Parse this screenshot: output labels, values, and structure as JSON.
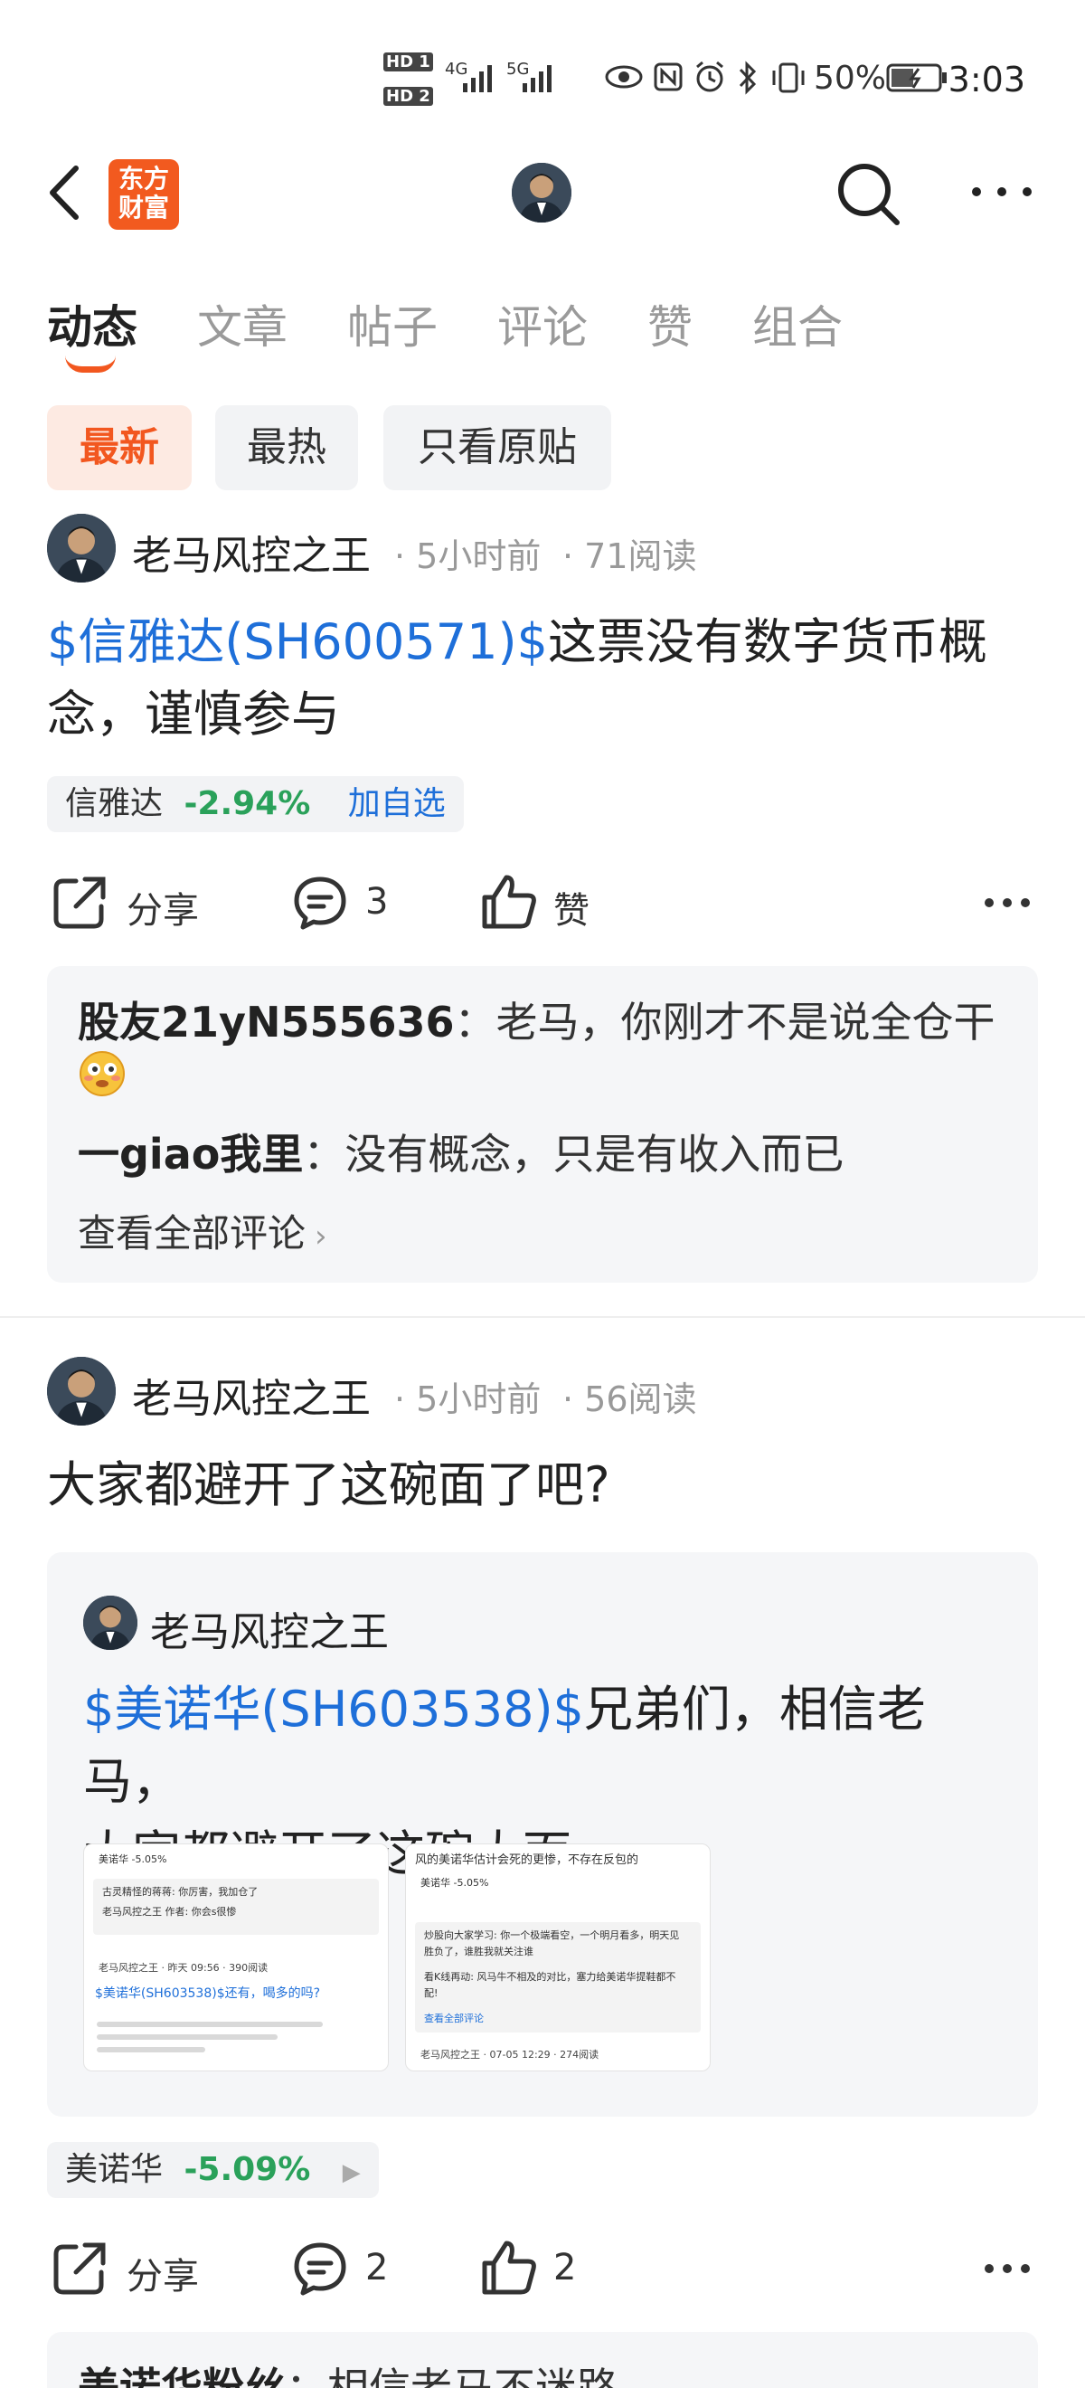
{
  "status_bar": {
    "hd1": "HD 1",
    "hd2": "HD 2",
    "net1": "4G",
    "net2": "5G",
    "battery": "50%",
    "time": "3:03"
  },
  "header": {
    "logo_line1": "东方",
    "logo_line2": "财富"
  },
  "tabs": [
    "动态",
    "文章",
    "帖子",
    "评论",
    "赞",
    "组合"
  ],
  "filters": [
    "最新",
    "最热",
    "只看原贴"
  ],
  "posts": [
    {
      "author": "老马风控之王",
      "time": "· 5小时前",
      "reads": "· 71阅读",
      "stock_link": "$信雅达(SH600571)$",
      "text": "这票没有数字货币概念，谨慎参与",
      "tag_name": "信雅达",
      "tag_change": "-2.94%",
      "tag_action": "加自选",
      "share": "分享",
      "comment_count": "3",
      "like": "赞",
      "comments": [
        {
          "user": "股友21yN555636",
          "sep": "：",
          "text": "老马，你刚才不是说全仓干"
        },
        {
          "user": "一giao我里",
          "sep": "：",
          "text": "没有概念，只是有收入而已"
        }
      ],
      "view_all": "查看全部评论"
    },
    {
      "author": "老马风控之王",
      "time": "· 5小时前",
      "reads": "· 56阅读",
      "text": "大家都避开了这碗面了吧?",
      "quote_author": "老马风控之王",
      "quote_link": "$美诺华(SH603538)$",
      "quote_text_1": "兄弟们，相信老马，",
      "quote_text_2": "大家都避开了这碗大面",
      "thumb1": {
        "tag": "美诺华 -5.05%",
        "c1": "古灵精怪的蒋蒋: 你厉害，我加仓了",
        "c2": "老马风控之王 作者: 你会s很惨",
        "author": "老马风控之王 · 昨天 09:56 · 390阅读",
        "link": "$美诺华(SH603538)$还有，喝多的吗?"
      },
      "thumb2": {
        "title": "风的美诺华估计会死的更惨，不存在反包的",
        "tag": "美诺华 -5.05%",
        "c1": "炒股向大家学习: 你一个极端看空，一个明月看多，明天见胜负了，谁胜我就关注谁",
        "c2": "看K线再动: 风马牛不相及的对比，塞力给美诺华提鞋都不配!",
        "view_all": "查看全部评论",
        "author": "老马风控之王 · 07-05 12:29 · 274阅读"
      },
      "tag_name": "美诺华",
      "tag_change": "-5.09%",
      "share": "分享",
      "comment_count": "2",
      "like_count": "2",
      "comment_preview_user": "美诺华粉丝",
      "comment_preview_text": "：相信老马不迷路"
    }
  ],
  "colors": {
    "accent": "#f2571f",
    "link": "#1e6fd9",
    "down": "#2aa15a"
  }
}
